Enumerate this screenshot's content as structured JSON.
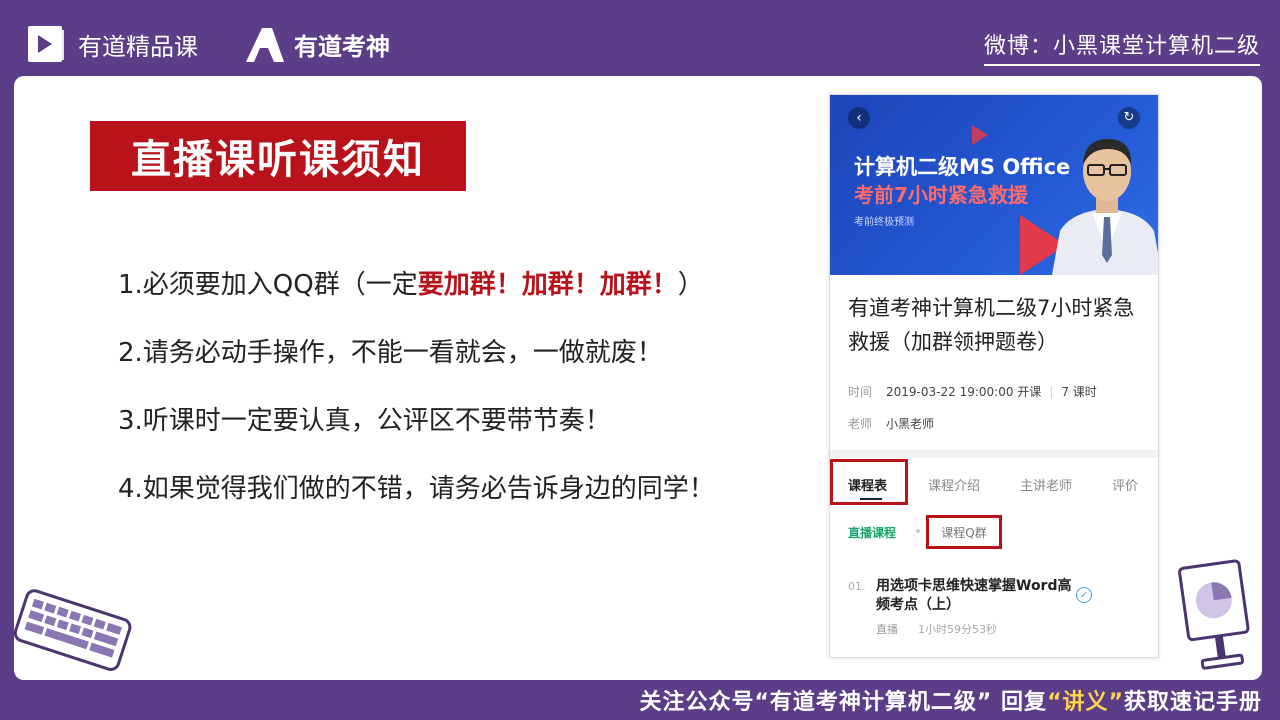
{
  "header": {
    "brand1": "有道精品课",
    "brand2": "有道考神",
    "weibo": "微博：小黑课堂计算机二级"
  },
  "slide": {
    "title": "直播课听课须知",
    "rules": [
      {
        "prefix": "1.必须要加入QQ群（一定",
        "emph": "要加群！加群！加群！",
        "suffix": "）"
      },
      {
        "text": "2.请务必动手操作，不能一看就会，一做就废！"
      },
      {
        "text": "3.听课时一定要认真，公评区不要带节奏！"
      },
      {
        "text": "4.如果觉得我们做的不错，请务必告诉身边的同学！"
      }
    ]
  },
  "phone": {
    "banner_line1": "计算机二级MS Office",
    "banner_line2": "考前7小时紧急救援",
    "banner_line3": "考前终极预测",
    "course_title": "有道考神计算机二级7小时紧急救援（加群领押题卷）",
    "time_label": "时间",
    "time_value": "2019-03-22 19:00:00 开课",
    "lessons_count": "7 课时",
    "teacher_label": "老师",
    "teacher_value": "小黑老师",
    "tabs": [
      "课程表",
      "课程介绍",
      "主讲老师",
      "评价"
    ],
    "sub_tabs": [
      "直播课程",
      "课程Q群"
    ],
    "lesson": {
      "num": "01.",
      "title": "用选项卡思维快速掌握Word高频考点（上）",
      "type": "直播",
      "duration": "1小时59分53秒"
    }
  },
  "footer": {
    "p1": "关注公众号",
    "p2": "“有道考神计算机二级”",
    "p3": " 回复",
    "p4": "“讲义”",
    "p5": "获取速记手册"
  },
  "colors": {
    "frame": "#5b3e87",
    "accent_red": "#b8121b",
    "banner_blue": "#2459d4",
    "footer_yellow": "#ffd54a"
  }
}
